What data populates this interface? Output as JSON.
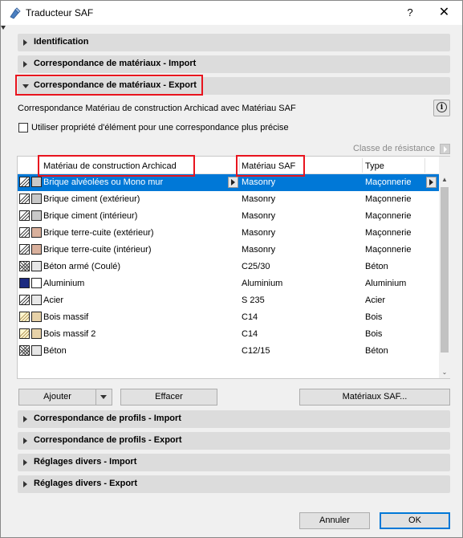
{
  "window": {
    "title": "Traducteur SAF",
    "help_label": "?",
    "close_label": "✕"
  },
  "sections_top": [
    {
      "label": "Identification",
      "expanded": false
    },
    {
      "label": "Correspondance de matériaux - Import",
      "expanded": false
    },
    {
      "label": "Correspondance de matériaux - Export",
      "expanded": true
    }
  ],
  "export_panel": {
    "description": "Correspondance Matériau de construction Archicad avec Matériau SAF",
    "info_icon": "info-icon",
    "checkbox_label": "Utiliser propriété d'élément pour une correspondance plus précise",
    "checkbox_checked": false,
    "resistance_label": "Classe de résistance"
  },
  "table": {
    "columns": [
      "Matériau de construction Archicad",
      "Matériau SAF",
      "Type"
    ],
    "rows": [
      {
        "name": "Brique alvéolées ou Mono mur",
        "saf": "Masonry",
        "type": "Maçonnerie",
        "swatch": "#c8c8c8",
        "selected": true
      },
      {
        "name": "Brique ciment (extérieur)",
        "saf": "Masonry",
        "type": "Maçonnerie",
        "swatch": "#c8c8c8",
        "selected": false
      },
      {
        "name": "Brique ciment (intérieur)",
        "saf": "Masonry",
        "type": "Maçonnerie",
        "swatch": "#c8c8c8",
        "selected": false
      },
      {
        "name": "Brique terre-cuite (extérieur)",
        "saf": "Masonry",
        "type": "Maçonnerie",
        "swatch": "#d9b09c",
        "selected": false
      },
      {
        "name": "Brique terre-cuite (intérieur)",
        "saf": "Masonry",
        "type": "Maçonnerie",
        "swatch": "#d9b09c",
        "selected": false
      },
      {
        "name": "Béton armé (Coulé)",
        "saf": "C25/30",
        "type": "Béton",
        "swatch": "#e6e6e6",
        "selected": false
      },
      {
        "name": "Aluminium",
        "saf": "Aluminium",
        "type": "Aluminium",
        "swatch": "#ffffff",
        "selected": false
      },
      {
        "name": "Acier",
        "saf": "S 235",
        "type": "Acier",
        "swatch": "#e8e8e8",
        "selected": false
      },
      {
        "name": "Bois massif",
        "saf": "C14",
        "type": "Bois",
        "swatch": "#e7d2a8",
        "selected": false
      },
      {
        "name": "Bois massif 2",
        "saf": "C14",
        "type": "Bois",
        "swatch": "#e7d2a8",
        "selected": false
      },
      {
        "name": "Béton",
        "saf": "C12/15",
        "type": "Béton",
        "swatch": "#e6e6e6",
        "selected": false
      }
    ]
  },
  "buttons": {
    "add": "Ajouter",
    "delete": "Effacer",
    "saf_materials": "Matériaux SAF...",
    "cancel": "Annuler",
    "ok": "OK"
  },
  "sections_bottom": [
    {
      "label": "Correspondance de profils - Import"
    },
    {
      "label": "Correspondance de profils - Export"
    },
    {
      "label": "Réglages divers - Import"
    },
    {
      "label": "Réglages divers - Export"
    }
  ],
  "colors": {
    "selection": "#0078d7",
    "highlight_box": "#e8141e"
  }
}
